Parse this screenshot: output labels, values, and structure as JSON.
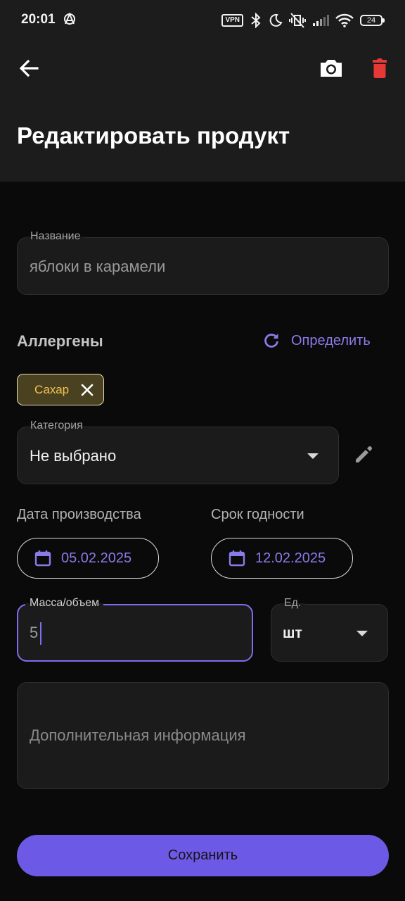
{
  "status_bar": {
    "time": "20:01",
    "vpn_label": "VPN",
    "battery_level": "24",
    "icons": [
      "vpn-icon",
      "bluetooth-icon",
      "do-not-disturb-icon",
      "vibrate-off-icon",
      "signal-icon",
      "wifi-icon",
      "battery-icon"
    ]
  },
  "appbar": {
    "title": "Редактировать продукт",
    "icons": [
      "back-arrow-icon",
      "camera-icon",
      "trash-icon"
    ],
    "delete_color": "#e53935"
  },
  "form": {
    "name": {
      "label": "Название",
      "value": "яблоки в карамели"
    },
    "allergens": {
      "title": "Аллергены",
      "detect_label": "Определить",
      "chips": [
        {
          "label": "Сахар"
        }
      ]
    },
    "category": {
      "label": "Категория",
      "value": "Не выбрано"
    },
    "dates": {
      "production_label": "Дата производства",
      "production_value": "05.02.2025",
      "expiry_label": "Срок годности",
      "expiry_value": "12.02.2025"
    },
    "mass": {
      "label": "Масса/объем",
      "value": "5"
    },
    "unit": {
      "label": "Ед.",
      "value": "шт"
    },
    "info": {
      "placeholder": "Дополнительная информация"
    },
    "save_label": "Сохранить"
  },
  "colors": {
    "accent": "#7c6ef0",
    "save_button": "#6c5ae6",
    "chip_text": "#f0c451",
    "chip_background": "#4a4120",
    "background": "#0a0a0a",
    "appbar": "#1c1c1c"
  }
}
